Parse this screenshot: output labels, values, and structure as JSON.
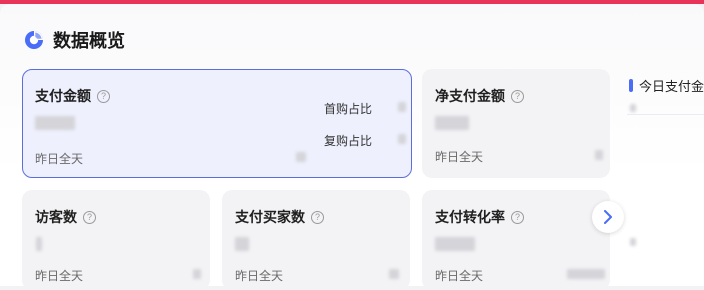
{
  "header": {
    "title": "数据概览"
  },
  "cards": [
    {
      "title": "支付金额",
      "compare_labels": [
        "首购占比",
        "复购占比"
      ],
      "sub_label": "昨日全天"
    },
    {
      "title": "净支付金额",
      "sub_label": "昨日全天"
    },
    {
      "title": "访客数",
      "sub_label": "昨日全天"
    },
    {
      "title": "支付买家数",
      "sub_label": "昨日全天"
    },
    {
      "title": "支付转化率",
      "sub_label": "昨日全天"
    }
  ],
  "right_panel": {
    "title": "今日支付金额"
  },
  "icons": {
    "help": "question-circle-icon",
    "next": "chevron-right-icon",
    "logo": "pie-chart-icon"
  },
  "colors": {
    "accent_top": "#e8335a",
    "primary": "#4a6cf7",
    "selected_border": "#5b6fdc",
    "selected_bg": "#eef0fd"
  }
}
